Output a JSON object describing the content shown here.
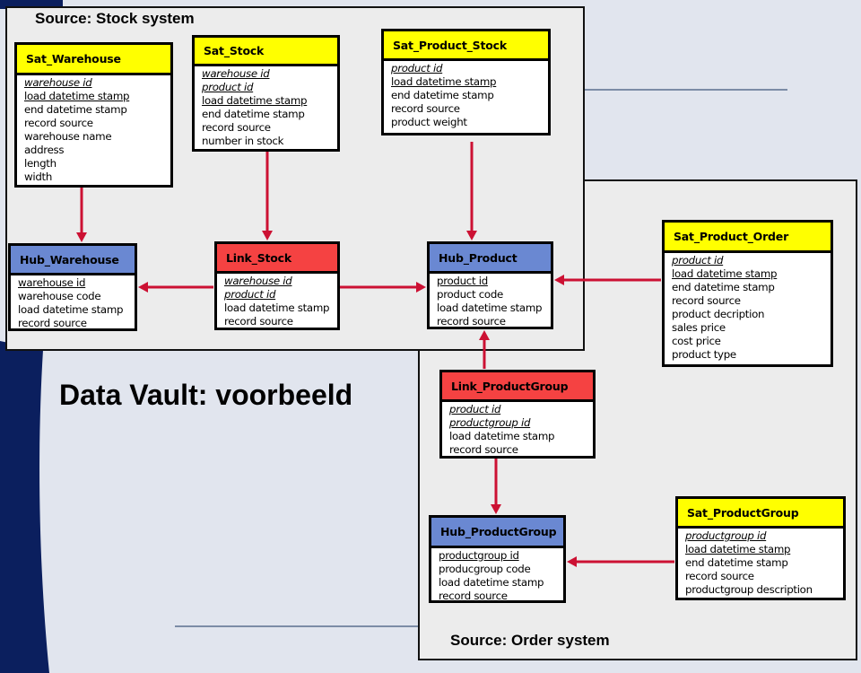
{
  "title": "Data Vault: voorbeeld",
  "colors": {
    "hub": "#6a88d2",
    "link": "#f54242",
    "sat": "#ffff00",
    "arrow": "#cc1133",
    "background": "#e1e5ee",
    "panel": "#ececec",
    "accent_strip": "#0b1f5e"
  },
  "panels": {
    "stock": {
      "title": "Source: Stock system"
    },
    "order": {
      "title": "Source: Order system"
    }
  },
  "entities": {
    "sat_warehouse": {
      "name": "Sat_Warehouse",
      "type": "sat",
      "fields": [
        {
          "label": "warehouse id",
          "key": "fk"
        },
        {
          "label": "load datetime stamp",
          "key": "pk"
        },
        {
          "label": "end datetime stamp",
          "key": ""
        },
        {
          "label": "record source",
          "key": ""
        },
        {
          "label": "warehouse name",
          "key": ""
        },
        {
          "label": "address",
          "key": ""
        },
        {
          "label": "length",
          "key": ""
        },
        {
          "label": "width",
          "key": ""
        }
      ]
    },
    "sat_stock": {
      "name": "Sat_Stock",
      "type": "sat",
      "fields": [
        {
          "label": "warehouse id",
          "key": "fk"
        },
        {
          "label": "product id",
          "key": "fk"
        },
        {
          "label": "load datetime stamp",
          "key": "pk"
        },
        {
          "label": "end datetime stamp",
          "key": ""
        },
        {
          "label": "record source",
          "key": ""
        },
        {
          "label": "number in stock",
          "key": ""
        }
      ]
    },
    "sat_product_stock": {
      "name": "Sat_Product_Stock",
      "type": "sat",
      "fields": [
        {
          "label": "product id",
          "key": "fk"
        },
        {
          "label": "load datetime stamp",
          "key": "pk"
        },
        {
          "label": "end datetime stamp",
          "key": ""
        },
        {
          "label": "record source",
          "key": ""
        },
        {
          "label": "product weight",
          "key": ""
        }
      ]
    },
    "hub_warehouse": {
      "name": "Hub_Warehouse",
      "type": "hub",
      "fields": [
        {
          "label": "warehouse id",
          "key": "pk"
        },
        {
          "label": "warehouse code",
          "key": ""
        },
        {
          "label": "load datetime stamp",
          "key": ""
        },
        {
          "label": "record source",
          "key": ""
        }
      ]
    },
    "link_stock": {
      "name": "Link_Stock",
      "type": "link",
      "fields": [
        {
          "label": "warehouse id",
          "key": "fk"
        },
        {
          "label": "product id",
          "key": "fk"
        },
        {
          "label": "load datetime stamp",
          "key": ""
        },
        {
          "label": "record source",
          "key": ""
        }
      ]
    },
    "hub_product": {
      "name": "Hub_Product",
      "type": "hub",
      "fields": [
        {
          "label": "product id",
          "key": "pk"
        },
        {
          "label": "product code",
          "key": ""
        },
        {
          "label": "load datetime stamp",
          "key": ""
        },
        {
          "label": "record source",
          "key": ""
        }
      ]
    },
    "sat_product_order": {
      "name": "Sat_Product_Order",
      "type": "sat",
      "fields": [
        {
          "label": "product id",
          "key": "fk"
        },
        {
          "label": "load datetime stamp",
          "key": "pk"
        },
        {
          "label": "end datetime stamp",
          "key": ""
        },
        {
          "label": "record source",
          "key": ""
        },
        {
          "label": "product decription",
          "key": ""
        },
        {
          "label": "sales price",
          "key": ""
        },
        {
          "label": "cost price",
          "key": ""
        },
        {
          "label": "product type",
          "key": ""
        }
      ]
    },
    "link_productgroup": {
      "name": "Link_ProductGroup",
      "type": "link",
      "fields": [
        {
          "label": "product id",
          "key": "fk"
        },
        {
          "label": "productgroup id",
          "key": "fk"
        },
        {
          "label": "load datetime stamp",
          "key": ""
        },
        {
          "label": "record source",
          "key": ""
        }
      ]
    },
    "hub_productgroup": {
      "name": "Hub_ProductGroup",
      "type": "hub",
      "fields": [
        {
          "label": "productgroup id",
          "key": "pk"
        },
        {
          "label": "producgroup code",
          "key": ""
        },
        {
          "label": "load datetime stamp",
          "key": ""
        },
        {
          "label": "record source",
          "key": ""
        }
      ]
    },
    "sat_productgroup": {
      "name": "Sat_ProductGroup",
      "type": "sat",
      "fields": [
        {
          "label": "productgroup id",
          "key": "fk"
        },
        {
          "label": "load datetime stamp",
          "key": "pk"
        },
        {
          "label": "end datetime stamp",
          "key": ""
        },
        {
          "label": "record source",
          "key": ""
        },
        {
          "label": "productgroup description",
          "key": ""
        }
      ]
    }
  },
  "relations": [
    {
      "from": "sat_warehouse",
      "to": "hub_warehouse"
    },
    {
      "from": "sat_stock",
      "to": "link_stock"
    },
    {
      "from": "sat_product_stock",
      "to": "hub_product"
    },
    {
      "from": "link_stock",
      "to": "hub_warehouse"
    },
    {
      "from": "link_stock",
      "to": "hub_product"
    },
    {
      "from": "sat_product_order",
      "to": "hub_product"
    },
    {
      "from": "link_productgroup",
      "to": "hub_product"
    },
    {
      "from": "link_productgroup",
      "to": "hub_productgroup"
    },
    {
      "from": "sat_productgroup",
      "to": "hub_productgroup"
    }
  ]
}
